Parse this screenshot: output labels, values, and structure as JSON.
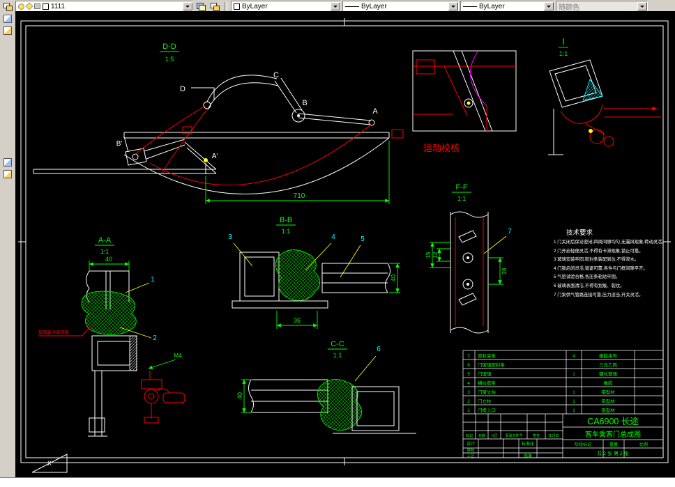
{
  "toolbar": {
    "layer_value": "1111",
    "color_value": "ByLayer",
    "linetype_value": "ByLayer",
    "lineweight_value": "ByLayer",
    "plotstyle_value": "随颜色"
  },
  "drawing": {
    "labels": {
      "dd": "D-D",
      "dd_scale": "1:5",
      "aa": "A-A",
      "bb": "B-B",
      "cc": "C-C",
      "ff": "F-F",
      "detail_i": "I",
      "scale_11": "1:1"
    },
    "points": {
      "a": "A",
      "b": "B",
      "c": "C",
      "d": "D",
      "a_prime": "A'",
      "b_prime": "B'"
    },
    "dims": {
      "d710": "710",
      "d40": "40",
      "d36": "36",
      "d12": "12",
      "d15": "15",
      "d28": "28"
    },
    "callouts": [
      "1",
      "2",
      "3",
      "4",
      "5",
      "6",
      "7"
    ],
    "m4": "M4",
    "glass_trim": "玻璃装卡装饰条",
    "motion_check": "运动校核",
    "ucs_x": "X",
    "tech": {
      "title": "技术要求",
      "items": [
        "1 门关闭后保证密闭,四周间隙均匀,无漏风现象,转动灵活。",
        "2 门开启轻便灵活,不得有卡滞现象,锁止可靠。",
        "3 玻璃安装牢固,密封条装配到位,不得渗水。",
        "4 门锁启闭灵活,锁紧可靠,各件与门框间隙平齐。",
        "5 气密试验合格,各压条粘贴牢固。",
        "6 玻璃表面清洁,不得有划痕、裂纹。",
        "7 门泵供气管路连接可靠,压力适当,开关灵活。"
      ]
    },
    "title_block": {
      "code": "CA6900 长途",
      "name": "客车乘客门总成图",
      "parts": [
        {
          "no": "7",
          "name": "密封夹条",
          "qty": "4",
          "mat": "橡胶夹布"
        },
        {
          "no": "6",
          "name": "门玻璃密封条",
          "qty": "",
          "mat": "三元乙丙"
        },
        {
          "no": "5",
          "name": "门玻璃",
          "qty": "1",
          "mat": "钢化玻璃"
        },
        {
          "no": "4",
          "name": "横拉胶条",
          "qty": "",
          "mat": "橡胶"
        },
        {
          "no": "3",
          "name": "门窗立柱",
          "qty": "1",
          "mat": "铝型材"
        },
        {
          "no": "2",
          "name": "门立柱",
          "qty": "1",
          "mat": "铝型材"
        },
        {
          "no": "1",
          "name": "门框上口",
          "qty": "1",
          "mat": "铝型材"
        }
      ],
      "fields": {
        "mark": "标记",
        "count": "处数",
        "zone": "分区",
        "change_doc": "更改文件号",
        "sign": "签名",
        "date": "年月日",
        "design": "设计",
        "check": "审核",
        "process": "工艺",
        "standard": "标准化",
        "approve": "批准",
        "stage": "阶段标记",
        "weight": "重量",
        "scale": "比例",
        "sheets": "共 2 张 第 2 张"
      }
    }
  }
}
